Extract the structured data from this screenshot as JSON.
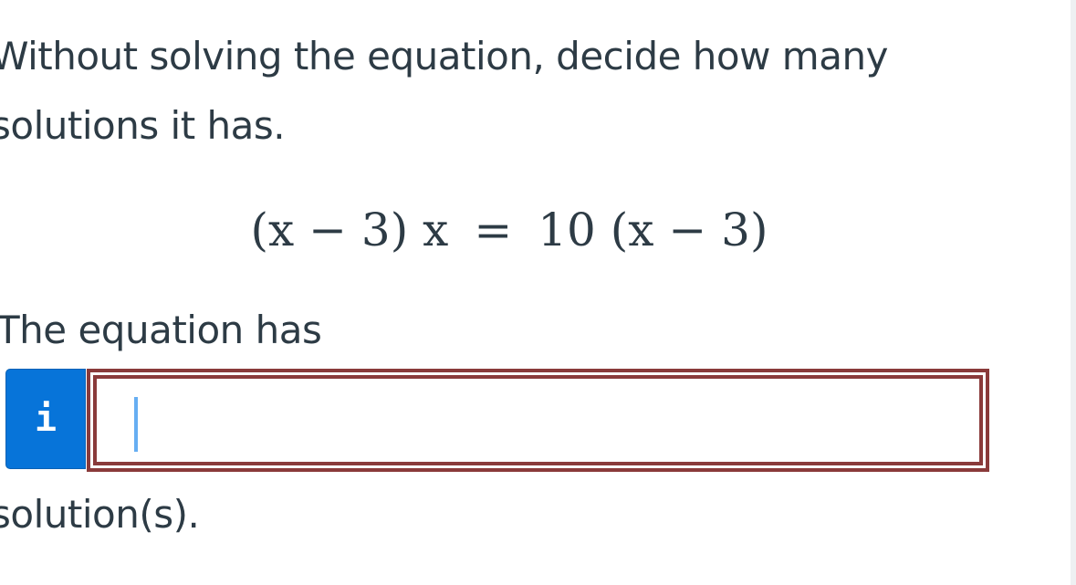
{
  "question": {
    "prompt": "Without solving the equation, decide how many solutions it has.",
    "equation": {
      "lhs": "(x − 3) x",
      "operator": "=",
      "rhs": "10 (x − 3)"
    },
    "lead_text": "The equation has",
    "trail_text": "solution(s)."
  },
  "answer": {
    "info_icon": "info-icon",
    "info_glyph": "i",
    "value": "",
    "focused": true
  },
  "colors": {
    "text": "#2d3b45",
    "info_button": "#0774d9",
    "field_border": "#8a3a3a",
    "caret": "#66aef2"
  }
}
